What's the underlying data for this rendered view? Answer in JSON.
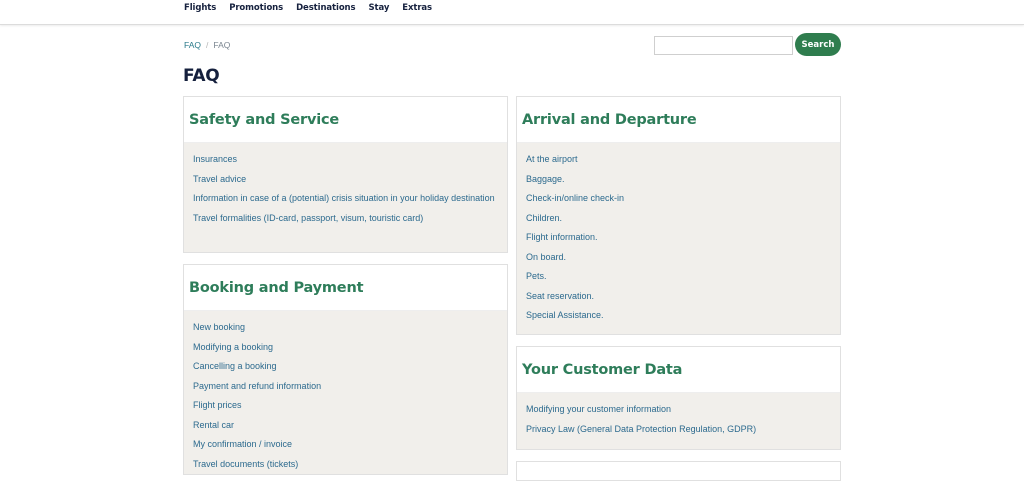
{
  "nav": {
    "items": [
      "Flights",
      "Promotions",
      "Destinations",
      "Stay",
      "Extras"
    ]
  },
  "breadcrumb": {
    "link": "FAQ",
    "separator": "/",
    "current": "FAQ"
  },
  "search": {
    "value": "",
    "placeholder": "",
    "button_label": "Search"
  },
  "page_title": "FAQ",
  "sections": {
    "safety": {
      "title": "Safety and Service",
      "items": [
        "Insurances",
        "Travel advice",
        "Information in case of a (potential) crisis situation in your holiday destination",
        "Travel formalities (ID-card, passport, visum, touristic card)"
      ]
    },
    "booking": {
      "title": "Booking and Payment",
      "items": [
        "New booking",
        "Modifying a booking",
        "Cancelling a booking",
        "Payment and refund information",
        "Flight prices",
        "Rental car",
        "My confirmation / invoice",
        "Travel documents (tickets)"
      ]
    },
    "arrival": {
      "title": "Arrival and Departure",
      "items": [
        "At the airport",
        "Baggage.",
        "Check-in/online check-in",
        "Children.",
        "Flight information.",
        "On board.",
        "Pets.",
        "Seat reservation.",
        "Special Assistance."
      ]
    },
    "customer": {
      "title": "Your Customer Data",
      "items": [
        "Modifying your customer information",
        "Privacy Law (General Data Protection Regulation, GDPR)"
      ]
    }
  },
  "colors": {
    "accent_green": "#2f7d4e",
    "heading_green": "#2e7d5a",
    "link_blue": "#2c6a8e",
    "card_bg": "#f1efeb",
    "title_navy": "#15203d"
  }
}
